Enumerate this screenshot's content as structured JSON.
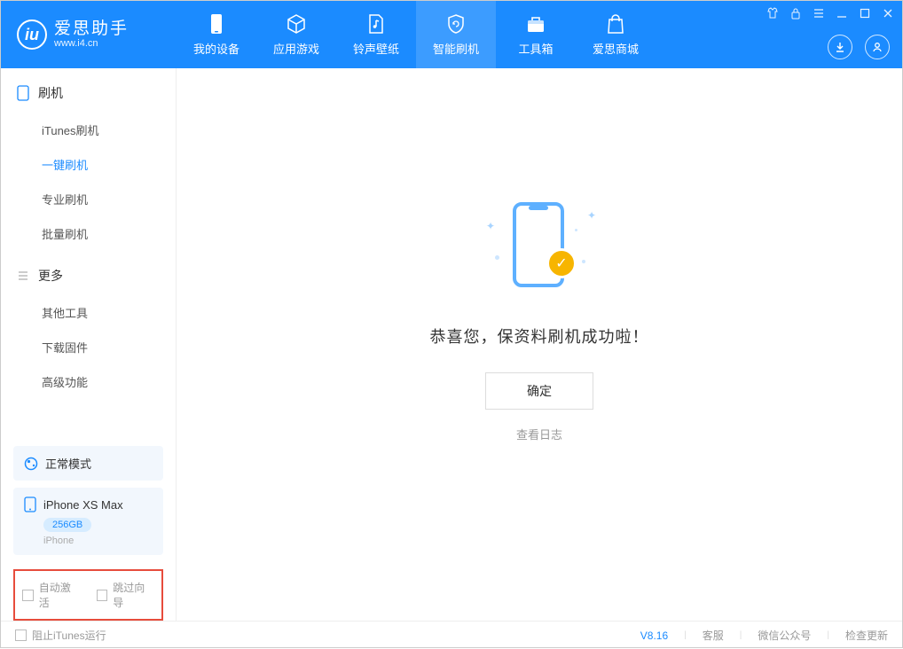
{
  "app": {
    "name": "爱思助手",
    "site": "www.i4.cn"
  },
  "nav": [
    {
      "label": "我的设备"
    },
    {
      "label": "应用游戏"
    },
    {
      "label": "铃声壁纸"
    },
    {
      "label": "智能刷机"
    },
    {
      "label": "工具箱"
    },
    {
      "label": "爱思商城"
    }
  ],
  "sidebar": {
    "section1": {
      "title": "刷机",
      "items": [
        "iTunes刷机",
        "一键刷机",
        "专业刷机",
        "批量刷机"
      ]
    },
    "section2": {
      "title": "更多",
      "items": [
        "其他工具",
        "下载固件",
        "高级功能"
      ]
    }
  },
  "device": {
    "mode": "正常模式",
    "name": "iPhone XS Max",
    "storage": "256GB",
    "type": "iPhone"
  },
  "checkboxes": {
    "auto_activate": "自动激活",
    "skip_guide": "跳过向导"
  },
  "main": {
    "success": "恭喜您，保资料刷机成功啦！",
    "confirm": "确定",
    "view_log": "查看日志"
  },
  "footer": {
    "block_itunes": "阻止iTunes运行",
    "version": "V8.16",
    "support": "客服",
    "wechat": "微信公众号",
    "update": "检查更新"
  }
}
